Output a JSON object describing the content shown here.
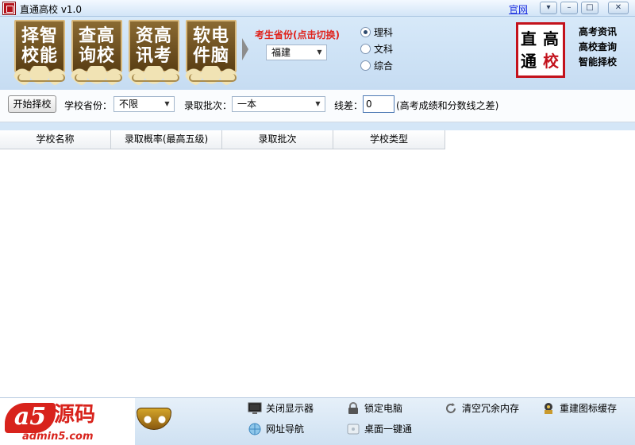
{
  "window": {
    "title": "直通高校 v1.0",
    "official_link": "官网",
    "buttons": {
      "menu": "▾",
      "minimize": "–",
      "maximize": "□",
      "close": "✕"
    }
  },
  "header": {
    "tiles": [
      {
        "line1": "择智",
        "line2": "校能"
      },
      {
        "line1": "查高",
        "line2": "询校"
      },
      {
        "line1": "资高",
        "line2": "讯考"
      },
      {
        "line1": "软电",
        "line2": "件脑"
      }
    ],
    "province_title": "考生省份(点击切换)",
    "province_value": "福建",
    "subjects": [
      {
        "label": "理科",
        "selected": true
      },
      {
        "label": "文科",
        "selected": false
      },
      {
        "label": "综合",
        "selected": false
      }
    ],
    "logo": {
      "c1": "直",
      "c2": "高",
      "c3": "通",
      "c4": "校"
    },
    "features": [
      "高考资讯",
      "高校查询",
      "智能择校"
    ]
  },
  "filter": {
    "start_button": "开始择校",
    "school_province_label": "学校省份：",
    "school_province_value": "不限",
    "batch_label": "录取批次：",
    "batch_value": "一本",
    "score_gap_label": "线差：",
    "score_gap_value": "0",
    "score_gap_note": "(高考成绩和分数线之差)"
  },
  "table": {
    "columns": [
      "学校名称",
      "录取概率(最高五级)",
      "录取批次",
      "学校类型"
    ],
    "rows": []
  },
  "footer": {
    "brand": {
      "mark": "a5",
      "name": "源码",
      "url": "admin5.com"
    },
    "tools": [
      {
        "icon": "monitor-icon",
        "label": "关闭显示器"
      },
      {
        "icon": "lock-icon",
        "label": "锁定电脑"
      },
      {
        "icon": "refresh-icon",
        "label": "清空冗余内存"
      },
      {
        "icon": "cache-icon",
        "label": "重建图标缓存"
      },
      {
        "icon": "globe-icon",
        "label": "网址导航"
      },
      {
        "icon": "desktop-icon",
        "label": "桌面一键通"
      }
    ]
  },
  "colors": {
    "accent_red": "#e0231c",
    "title_bg": "#d2e5f7",
    "link": "#1a2ee0"
  }
}
